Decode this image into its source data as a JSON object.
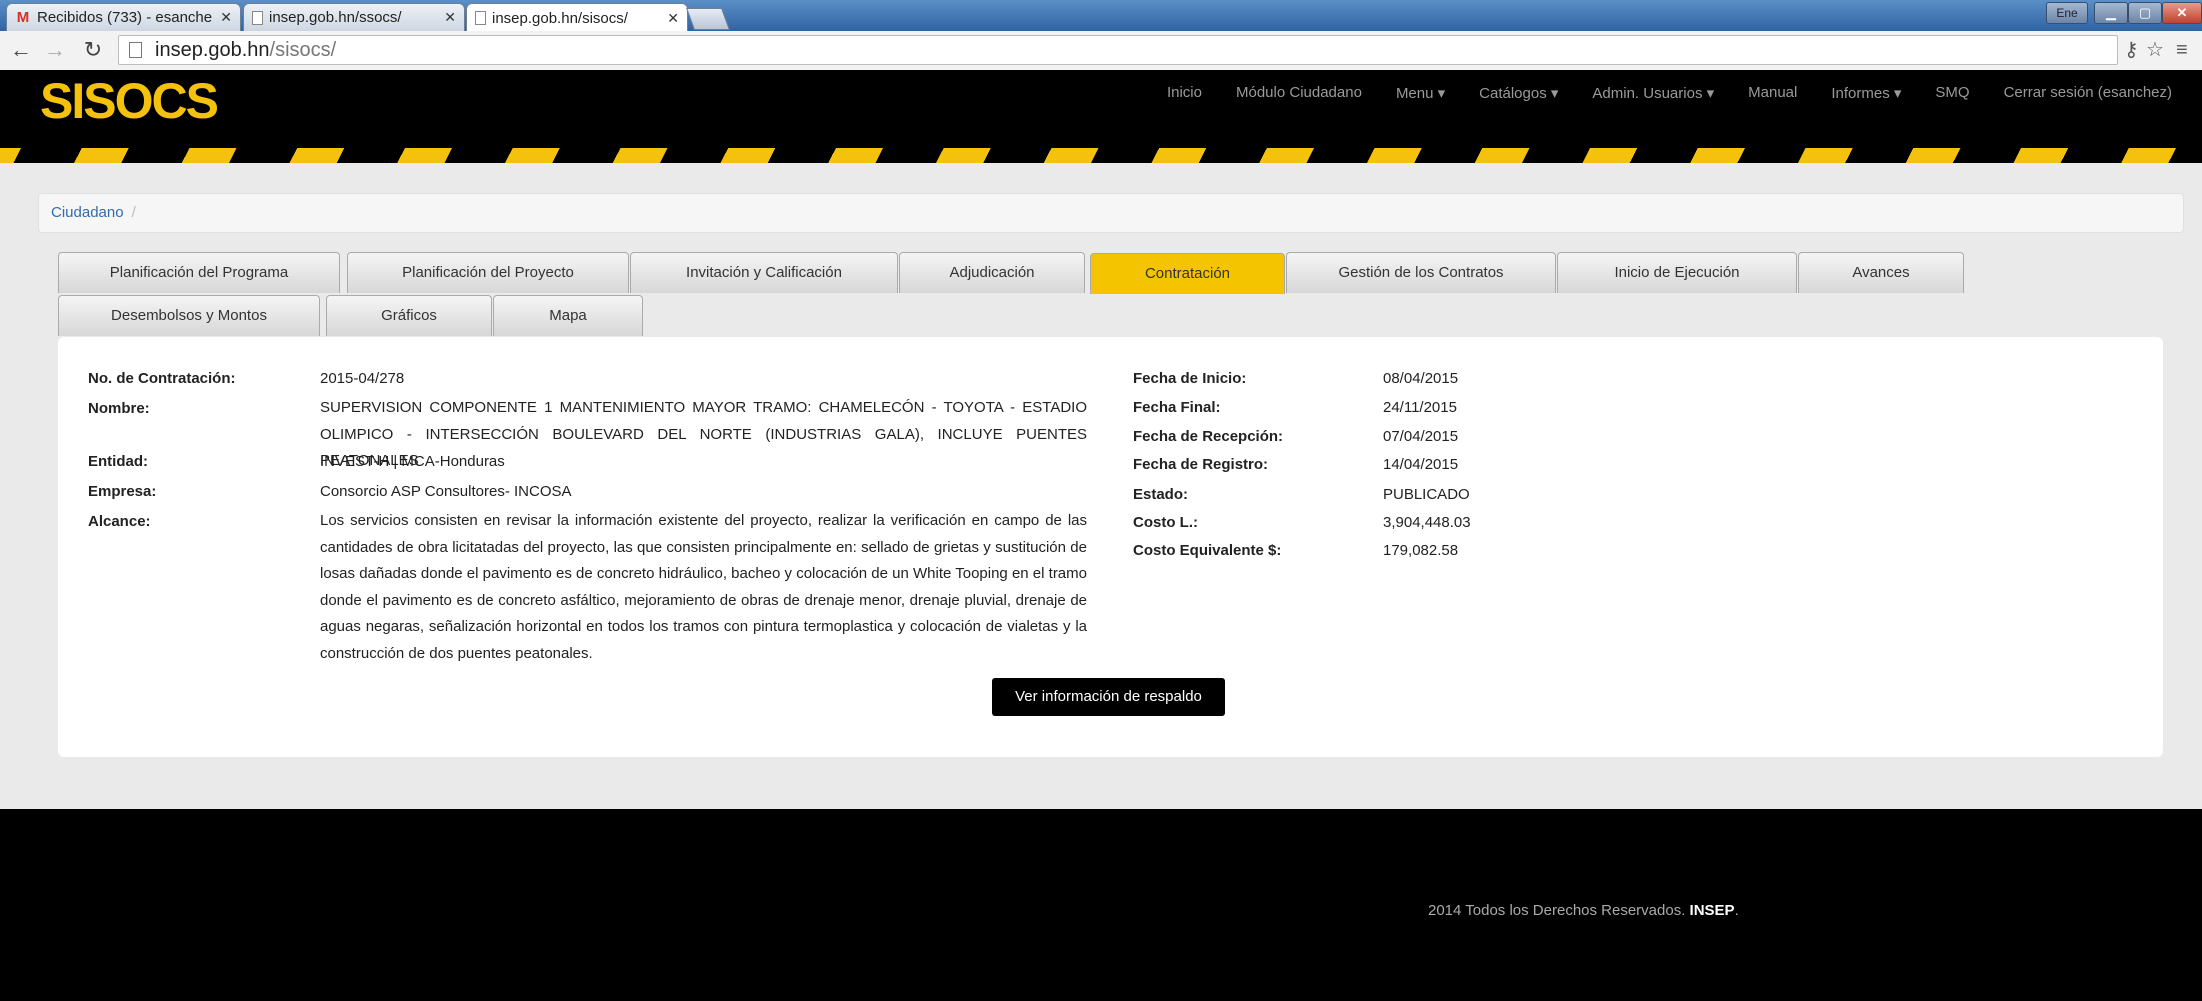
{
  "browser": {
    "tabs": [
      {
        "label": "Recibidos (733) - esanche",
        "icon": "gmail-icon"
      },
      {
        "label": "insep.gob.hn/ssocs/",
        "icon": "page-icon"
      },
      {
        "label": "insep.gob.hn/sisocs/",
        "icon": "page-icon"
      }
    ],
    "url_host": "insep.gob.hn",
    "url_path": "/sisocs/",
    "user_badge": "Ene"
  },
  "site": {
    "logo": "SISOCS",
    "nav": [
      "Inicio",
      "Módulo Ciudadano",
      "Menu ▾",
      "Catálogos ▾",
      "Admin. Usuarios ▾",
      "Manual",
      "Informes ▾",
      "SMQ",
      "Cerrar sesión (esanchez)"
    ],
    "breadcrumb": "Ciudadano",
    "breadcrumb_sep": "/"
  },
  "tabs_row1": [
    "Planificación del Programa",
    "Planificación del Proyecto",
    "Invitación y Calificación",
    "Adjudicación",
    "Contratación",
    "Gestión de los Contratos",
    "Inicio de Ejecución",
    "Avances"
  ],
  "tabs_row2": [
    "Desembolsos y Montos",
    "Gráficos",
    "Mapa"
  ],
  "active_tab": "Contratación",
  "details": {
    "contratacion_label": "No. de Contratación:",
    "contratacion_value": "2015-04/278",
    "nombre_label": "Nombre:",
    "nombre_value": "SUPERVISION COMPONENTE 1 MANTENIMIENTO MAYOR TRAMO: CHAMELECÓN - TOYOTA - ESTADIO OLIMPICO - INTERSECCIÓN BOULEVARD DEL NORTE (INDUSTRIAS GALA), INCLUYE PUENTES PEATONALES",
    "entidad_label": "Entidad:",
    "entidad_value": "INVEST-H | MCA-Honduras",
    "empresa_label": "Empresa:",
    "empresa_value": "Consorcio ASP Consultores- INCOSA",
    "alcance_label": "Alcance:",
    "alcance_value": "Los servicios consisten en revisar la información existente del proyecto, realizar la verificación en campo de las cantidades de obra licitatadas del proyecto, las que consisten principalmente en: sellado de grietas y sustitución de losas dañadas donde el pavimento es de concreto hidráulico, bacheo y colocación de un White Tooping en el tramo donde el pavimento es de concreto asfáltico, mejoramiento de obras de drenaje menor, drenaje pluvial, drenaje de aguas negaras, señalización horizontal en todos los tramos con pintura termoplastica y colocación de vialetas y la construcción de dos puentes peatonales.",
    "fecha_inicio_label": "Fecha de Inicio:",
    "fecha_inicio_value": "08/04/2015",
    "fecha_final_label": "Fecha Final:",
    "fecha_final_value": "24/11/2015",
    "fecha_recepcion_label": "Fecha de Recepción:",
    "fecha_recepcion_value": "07/04/2015",
    "fecha_registro_label": "Fecha de Registro:",
    "fecha_registro_value": "14/04/2015",
    "estado_label": "Estado:",
    "estado_value": "PUBLICADO",
    "costo_l_label": "Costo L.:",
    "costo_l_value": "3,904,448.03",
    "costo_eq_label": "Costo Equivalente $:",
    "costo_eq_value": "179,082.58"
  },
  "respaldo_button": "Ver información de respaldo",
  "footer": {
    "text": "2014 Todos los Derechos Reservados.",
    "brand": "INSEP",
    "dot": "."
  },
  "colors": {
    "brand_yellow": "#f4c20d",
    "active_tab": "#f5c400",
    "header_bg": "#000000"
  }
}
